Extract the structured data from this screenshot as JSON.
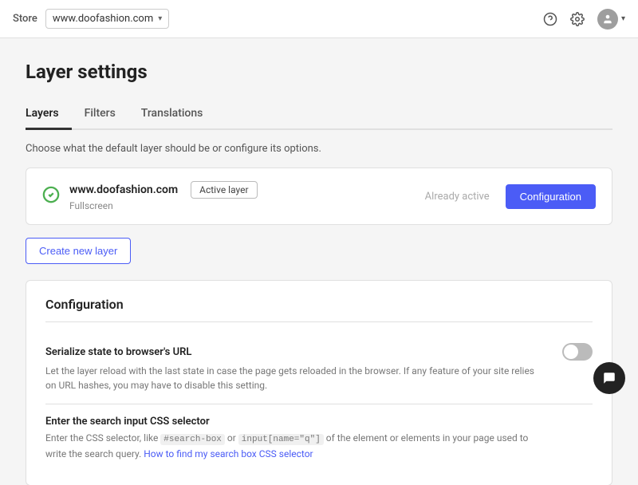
{
  "topNav": {
    "store_label": "Store",
    "store_url": "www.doofashion.com",
    "chevron": "▾"
  },
  "header": {
    "title": "Layer settings"
  },
  "tabs": [
    {
      "id": "layers",
      "label": "Layers",
      "active": true
    },
    {
      "id": "filters",
      "label": "Filters",
      "active": false
    },
    {
      "id": "translations",
      "label": "Translations",
      "active": false
    }
  ],
  "tab_description": "Choose what the default layer should be or configure its options.",
  "layer": {
    "url": "www.doofashion.com",
    "type": "Fullscreen",
    "badge": "Active layer",
    "already_active": "Already active",
    "config_btn": "Configuration"
  },
  "create_btn": "Create new layer",
  "config_section": {
    "title": "Configuration",
    "items": [
      {
        "id": "serialize-state",
        "title": "Serialize state to browser's URL",
        "description": "Let the layer reload with the last state in case the page gets reloaded in the browser. If any feature of your site relies on URL hashes, you may have to disable this setting.",
        "toggle": false
      },
      {
        "id": "search-input-css",
        "title": "Enter the search input CSS selector",
        "description_prefix": "Enter the CSS selector, like ",
        "code1": "#search-box",
        "desc_mid": " or ",
        "code2": "input[name=\"q\"]",
        "description_suffix": " of the element or elements in your page used to write the search query. ",
        "link_text": "How to find my search box CSS selector",
        "link_href": "#"
      }
    ]
  },
  "chat_icon": "💬"
}
